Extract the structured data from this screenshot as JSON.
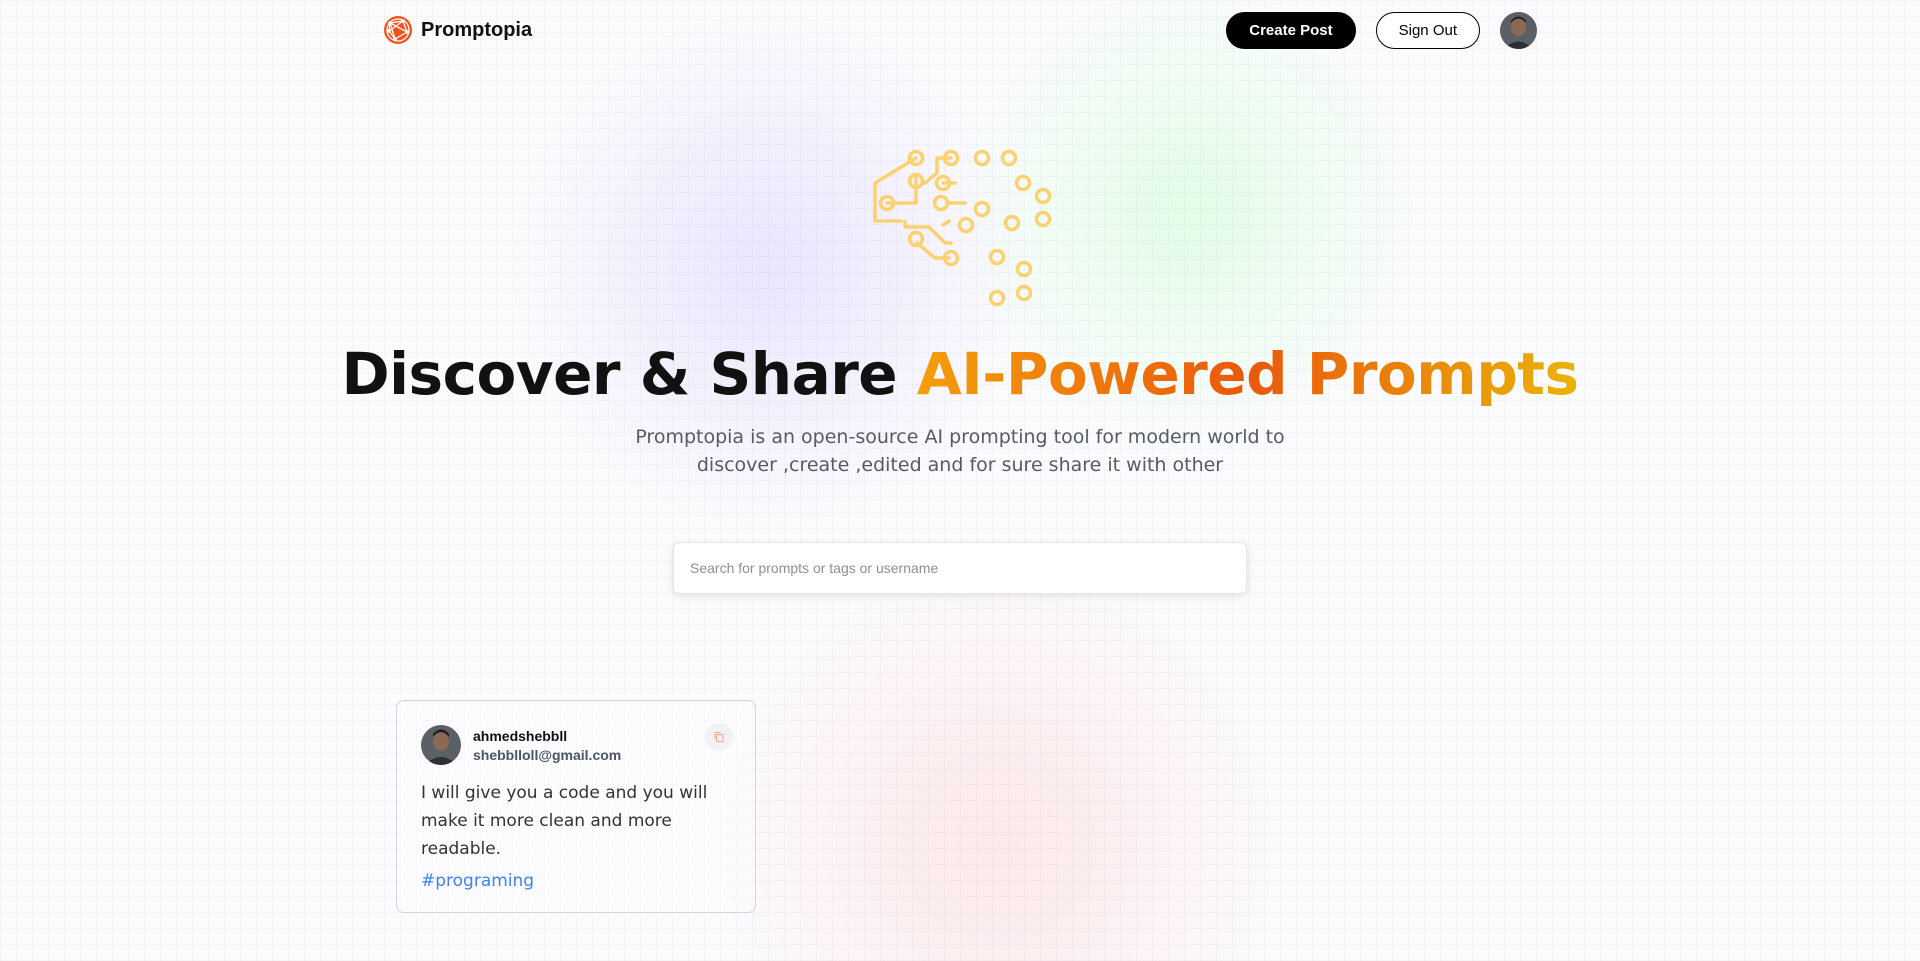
{
  "colors": {
    "brand": "#f4511e",
    "accent_start": "#f59e0b",
    "accent_mid": "#ea580c",
    "tag_blue": "#3b82f6",
    "hero_art": "#fcd170"
  },
  "nav": {
    "brand_name": "Promptopia",
    "logo_icon": "globe-network-logo",
    "create_post": "Create Post",
    "sign_out": "Sign Out",
    "avatar_icon": "user-avatar"
  },
  "hero": {
    "art_icon": "circuit-brain-icon",
    "headline_plain": "Discover & Share ",
    "headline_accent": "AI-Powered Prompts",
    "description": "Promptopia is an open-source AI prompting tool for modern world to discover ,create ,edited and for sure share it with other"
  },
  "search": {
    "placeholder": "Search for prompts or tags or username",
    "value": ""
  },
  "feed": {
    "cards": [
      {
        "username": "ahmedshebbll",
        "email": "shebblloll@gmail.com",
        "prompt": "I will give you a code and you will make it more clean and more readable.",
        "tag": "#programing",
        "copy_icon": "copy-icon"
      }
    ]
  }
}
